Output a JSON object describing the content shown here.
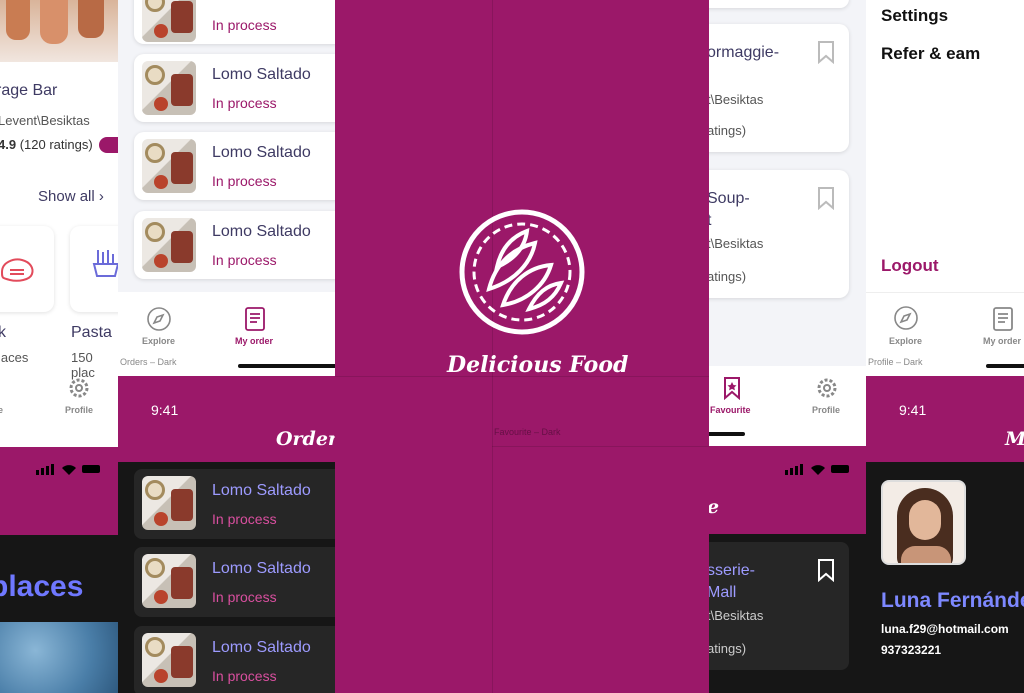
{
  "colors": {
    "accent": "#9b1869",
    "dark": "#161616",
    "link": "#9d9bff"
  },
  "left": {
    "place_title": "rage Bar",
    "place_address": "Levent\\Besiktas",
    "rating_value": "4.9",
    "rating_count": "(120 ratings)",
    "show_all": "Show all",
    "categories": [
      {
        "label": "k",
        "sub": "laces"
      },
      {
        "label": "Pasta",
        "sub": "150 plac"
      }
    ],
    "nav": {
      "profile": "Profile",
      "home": "e"
    },
    "dark_heading": "places"
  },
  "orders": {
    "items": [
      {
        "name": "Lomo Saltado",
        "status": "In process"
      },
      {
        "name": "Lomo Saltado",
        "status": "In process"
      },
      {
        "name": "Lomo Saltado",
        "status": "In process"
      },
      {
        "name": "Lomo Saltado",
        "status": "In process"
      }
    ],
    "nav": {
      "explore": "Explore",
      "my_order": "My order"
    },
    "frame_caption": "Orders – Dark",
    "dark_time": "9:41",
    "dark_title": "Orders",
    "dark_items": [
      {
        "name": "Lomo Saltado",
        "status": "In process"
      },
      {
        "name": "Lomo Saltado",
        "status": "In process"
      },
      {
        "name": "Lomo Saltado",
        "status": "In process"
      }
    ]
  },
  "splash": {
    "brand": "Delicious Food",
    "caption": "Favourite – Dark"
  },
  "favourites": {
    "items": [
      {
        "name": "ormaggie-",
        "address": "t\\Besiktas",
        "ratings": "atings)"
      },
      {
        "name": "Soup-",
        "name2": "t",
        "address": "t\\Besiktas",
        "ratings": "atings)"
      }
    ],
    "nav": {
      "favourite": "Favourite",
      "profile": "Profile"
    },
    "dark_title_frag": "e",
    "dark_item": {
      "name": "sserie-",
      "name2": "Mall",
      "address": "t\\Besiktas",
      "ratings": "atings)"
    }
  },
  "profile": {
    "menu": [
      "Settings",
      "Refer & eam"
    ],
    "logout": "Logout",
    "nav": {
      "explore": "Explore",
      "my_order": "My order"
    },
    "frame_caption": "Profile – Dark",
    "dark_time": "9:41",
    "dark_title_frag": "M",
    "user_name": "Luna Fernánde",
    "user_email": "luna.f29@hotmail.com",
    "user_phone": "937323221"
  }
}
